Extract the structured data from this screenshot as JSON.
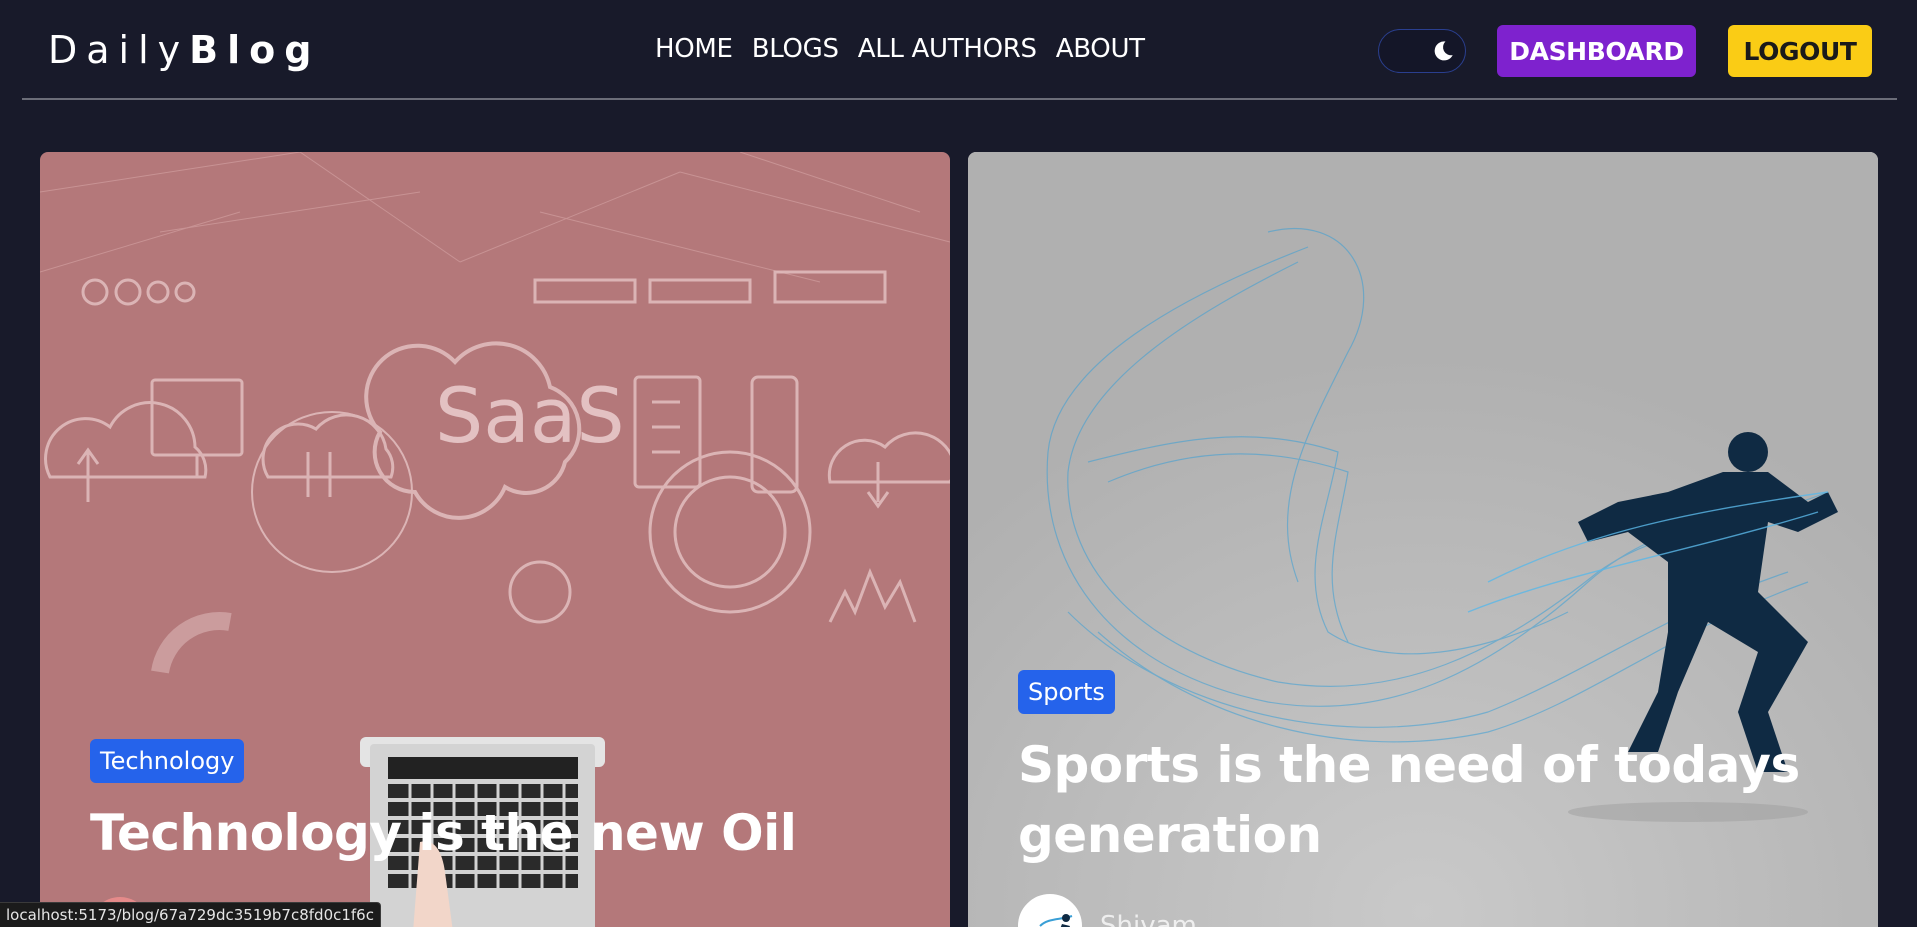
{
  "header": {
    "logo_light": "Daily",
    "logo_bold": "Blog",
    "nav": [
      "HOME",
      "BLOGS",
      "ALL AUTHORS",
      "ABOUT"
    ],
    "theme_toggle_icon": "moon-icon",
    "dashboard_label": "DASHBOARD",
    "logout_label": "LOGOUT"
  },
  "colors": {
    "background": "#181a2a",
    "dashboard": "#7e22ce",
    "logout": "#facc15",
    "badge": "#2563eb"
  },
  "posts": [
    {
      "category": "Technology",
      "title": "Technology is the new Oil",
      "author": "",
      "image_text": "SaaS"
    },
    {
      "category": "Sports",
      "title_line1": "Sports is the need of todays",
      "title_line2": "generation",
      "author": "Shivam"
    }
  ],
  "status_bar": {
    "url": "localhost:5173/blog/67a729dc3519b7c8fd0c1f6c"
  }
}
